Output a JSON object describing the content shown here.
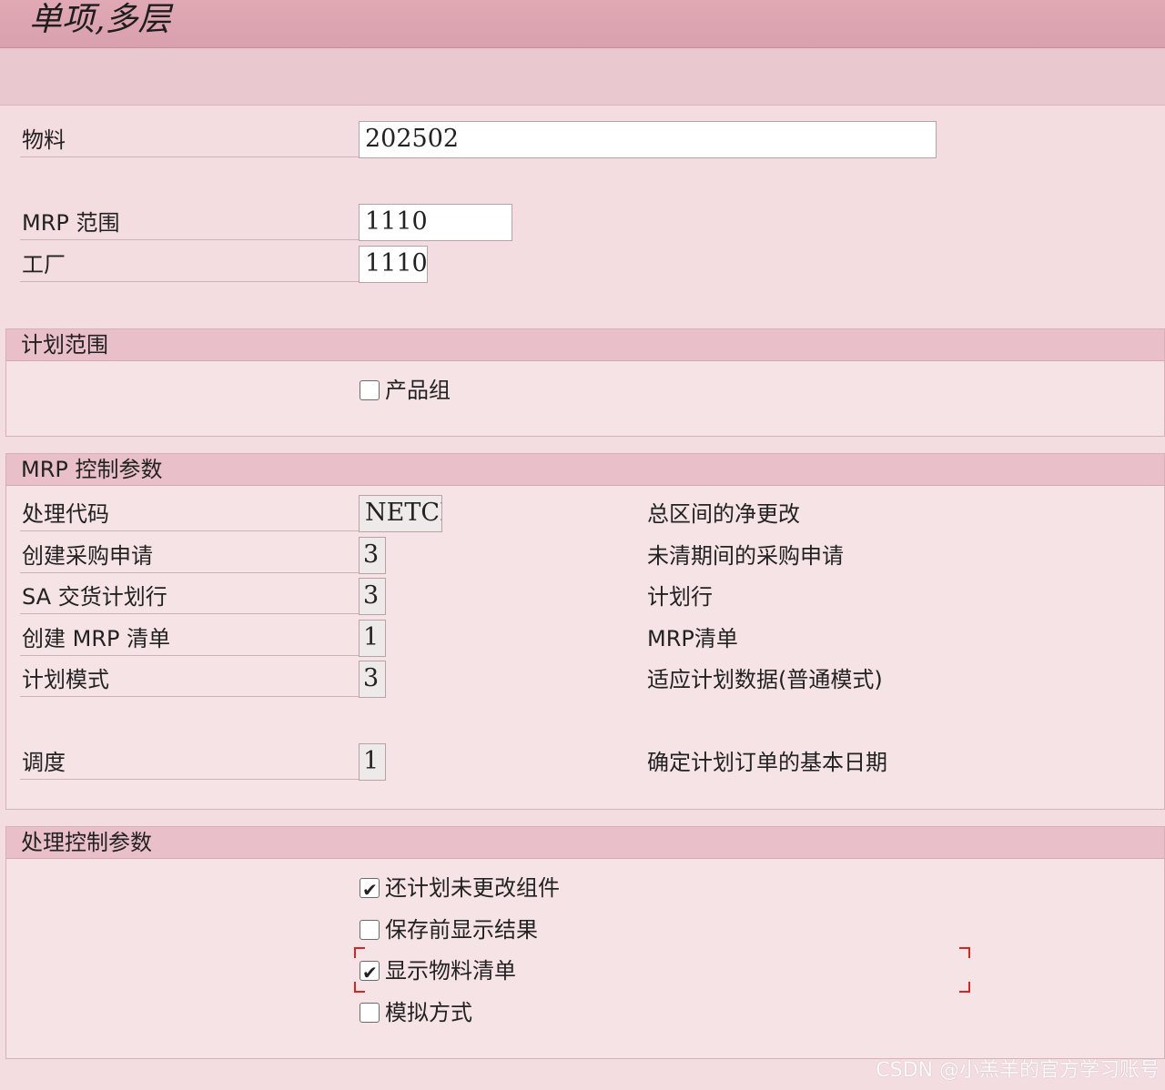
{
  "window": {
    "title": "单项,多层"
  },
  "fields": {
    "material": {
      "label": "物料",
      "value": "202502"
    },
    "mrp_area": {
      "label": "MRP 范围",
      "value": "1110"
    },
    "plant": {
      "label": "工厂",
      "value": "1110"
    }
  },
  "planning_scope": {
    "title": "计划范围",
    "product_group": {
      "label": "产品组",
      "checked": false
    }
  },
  "mrp_control": {
    "title": "MRP 控制参数",
    "rows": [
      {
        "label": "处理代码",
        "value": "NETCH",
        "desc": "总区间的净更改"
      },
      {
        "label": "创建采购申请",
        "value": "3",
        "desc": "未清期间的采购申请"
      },
      {
        "label": "SA 交货计划行",
        "value": "3",
        "desc": "计划行"
      },
      {
        "label": "创建 MRP 清单",
        "value": "1",
        "desc": "MRP清单"
      },
      {
        "label": "计划模式",
        "value": "3",
        "desc": "适应计划数据(普通模式)"
      },
      {
        "label": "调度",
        "value": "1",
        "desc": "确定计划订单的基本日期"
      }
    ]
  },
  "process_control": {
    "title": "处理控制参数",
    "options": [
      {
        "label": "还计划未更改组件",
        "checked": true
      },
      {
        "label": "保存前显示结果",
        "checked": false
      },
      {
        "label": "显示物料清单",
        "checked": true
      },
      {
        "label": "模拟方式",
        "checked": false
      }
    ]
  },
  "watermark": "CSDN @小羔羊的官方学习账号",
  "colors": {
    "title_bar": "#d9a0ad",
    "group_header": "#e9c0c9",
    "background": "#f3dde1"
  }
}
